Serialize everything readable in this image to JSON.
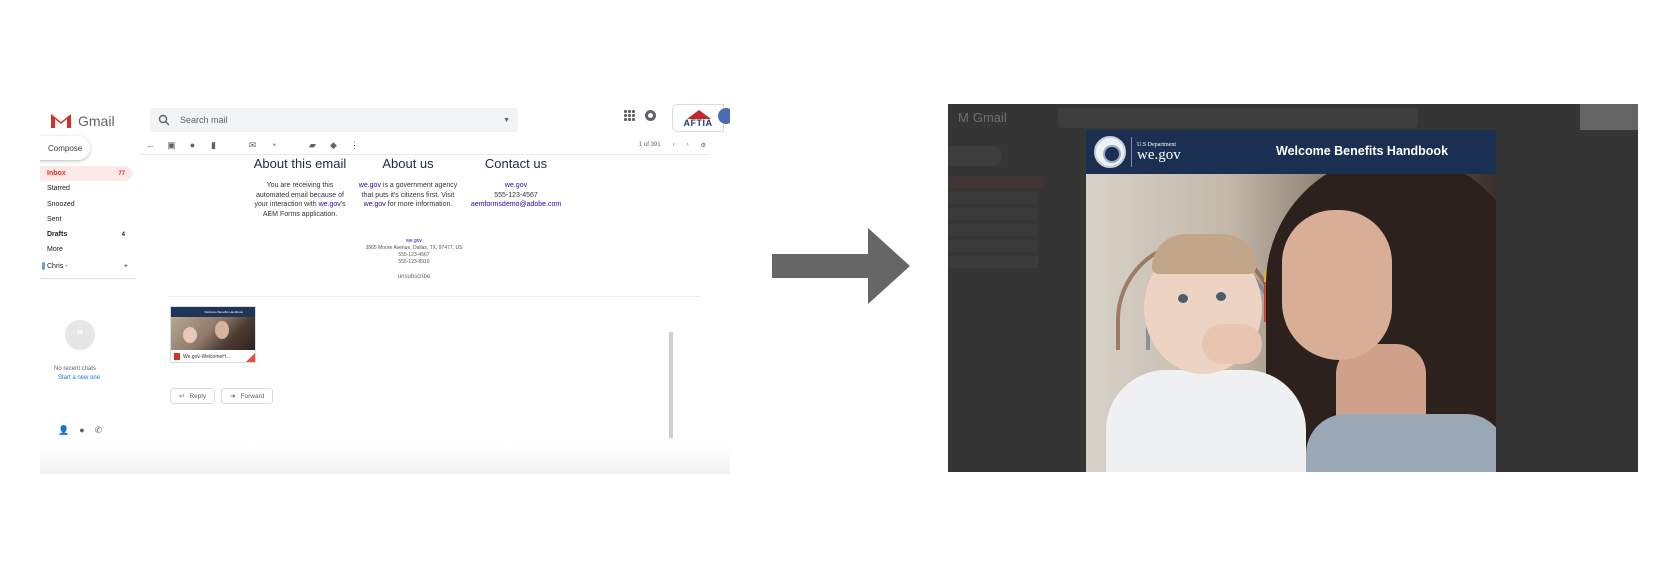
{
  "gmail": {
    "brand": "Gmail",
    "search_placeholder": "Search mail",
    "aftia_logo": "AFTIA",
    "compose_label": "Compose",
    "nav": [
      {
        "label": "Inbox",
        "count": "77"
      },
      {
        "label": "Starred",
        "count": ""
      },
      {
        "label": "Snoozed",
        "count": ""
      },
      {
        "label": "Sent",
        "count": ""
      },
      {
        "label": "Drafts",
        "count": "4"
      },
      {
        "label": "More",
        "count": ""
      }
    ],
    "account_label": "Chris",
    "account_caret": "-",
    "add_label": "+",
    "no_chats": "No recent chats",
    "start_new": "Start a new one",
    "pager": "1 of 391",
    "email": {
      "about_email_title": "About this email",
      "about_email_text": "You are receiving this automated email because of your interaction with",
      "about_email_link": "we.gov",
      "about_email_suffix": "'s AEM Forms application.",
      "about_us_title": "About us",
      "about_us_link": "we.gov",
      "about_us_text": "is a government agency that puts it's citizens first. Visit",
      "about_us_link2": "we.gov",
      "about_us_suffix": "for more information.",
      "contact_title": "Contact us",
      "contact_link": "we.gov",
      "contact_phone": "555-123-4567",
      "contact_email": "aemformsdemo@adobe.com",
      "addr_link": "we.gov",
      "addr_line1": "3565 Moore Avenue, Dallas, TX, 97477, US",
      "addr_line2": "555-123-4567",
      "addr_line3": "555-123-8910",
      "unsubscribe": "unsubscribe"
    },
    "attachment_name": "We.gov-WelcomeH...",
    "attachment_thumb_title": "Welcome Benefits Handbook",
    "reply_label": "Reply",
    "forward_label": "Forward"
  },
  "preview": {
    "dept_small": "U.S Department",
    "dept_big": "we.gov",
    "title": "Welcome Benefits Handbook"
  },
  "colors": {
    "arrow": "#666666",
    "header_navy": "#1b2f52",
    "inbox_red": "#d93025",
    "link_blue": "#1a0dab"
  }
}
